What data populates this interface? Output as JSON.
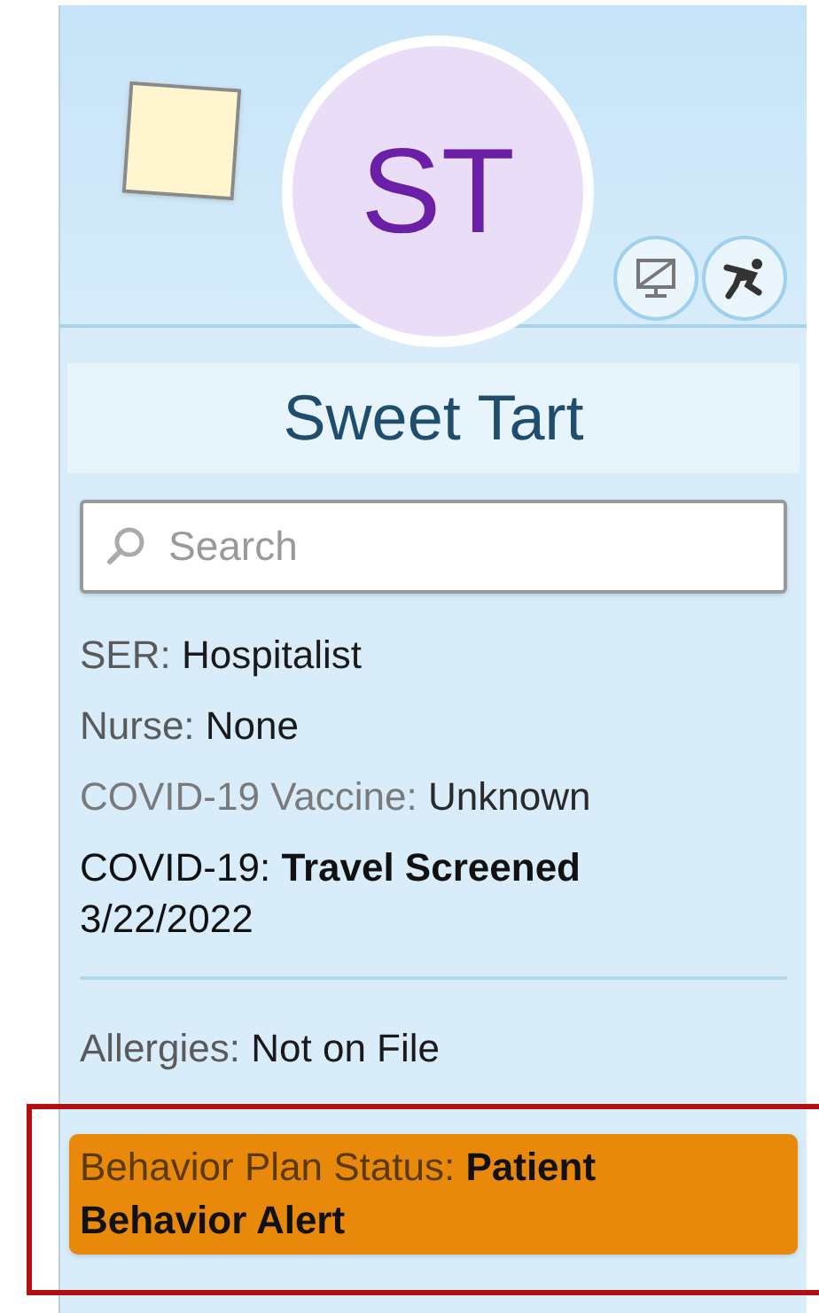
{
  "patient": {
    "initials": "ST",
    "name": "Sweet Tart"
  },
  "search": {
    "placeholder": "Search"
  },
  "details": [
    {
      "label": "SER:",
      "value": "Hospitalist",
      "kind": "plain"
    },
    {
      "label": "Nurse:",
      "value": "None",
      "kind": "plain"
    },
    {
      "label": "COVID-19 Vaccine:",
      "value": "Unknown",
      "kind": "muted"
    },
    {
      "label": "COVID-19:",
      "value": "Travel Screened",
      "date": "3/22/2022",
      "kind": "emphasis"
    }
  ],
  "allergies": {
    "label": "Allergies:",
    "value": "Not on File"
  },
  "behavior_alert": {
    "label": "Behavior Plan Status:",
    "value": "Patient Behavior Alert",
    "color": "#e8890c",
    "highlighted": true
  }
}
